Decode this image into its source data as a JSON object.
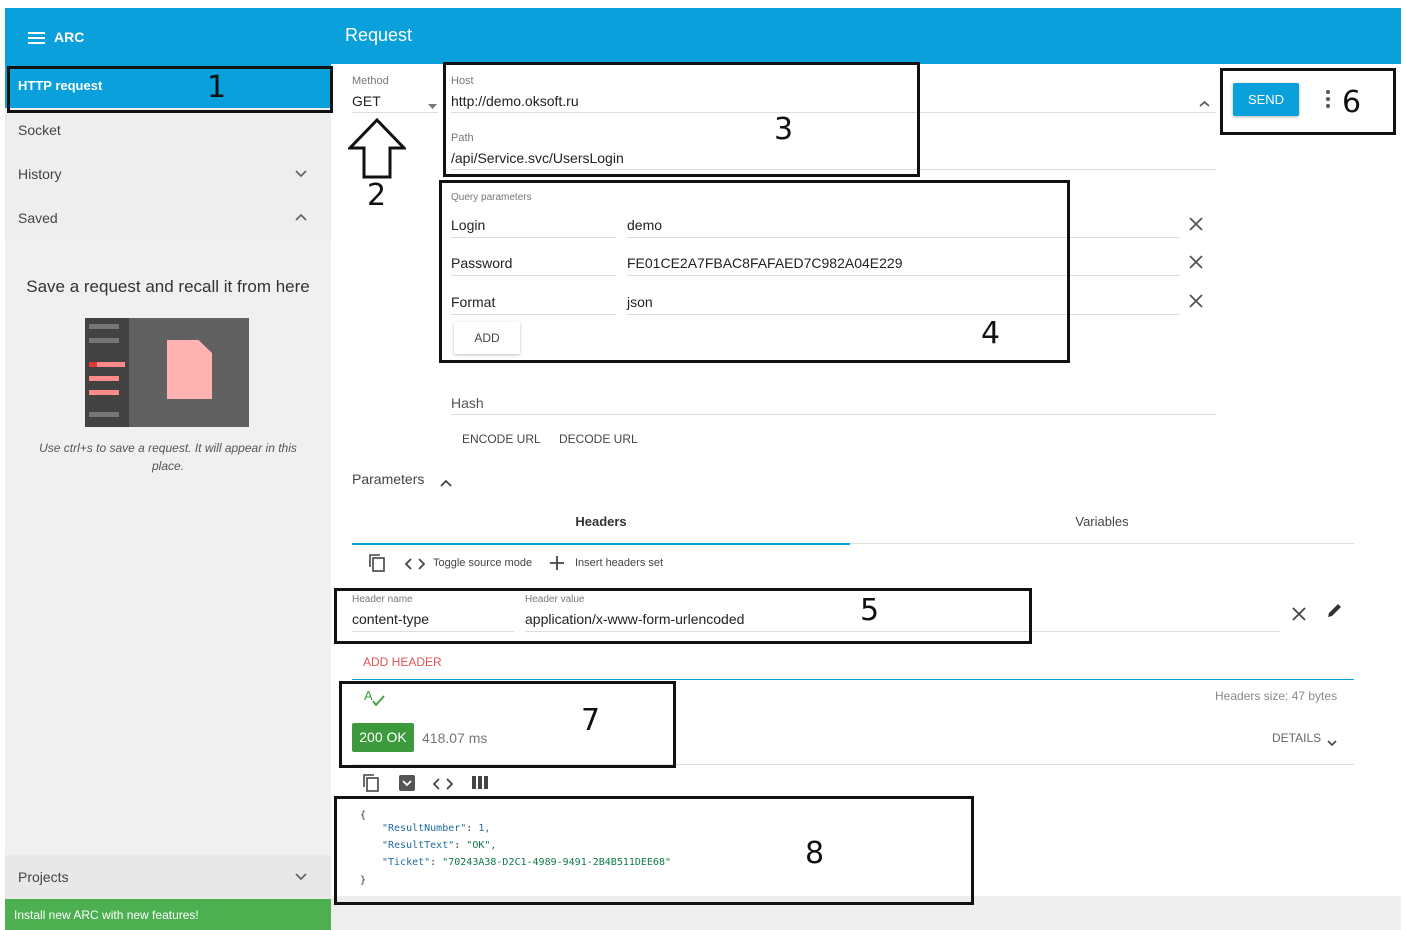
{
  "header": {
    "app_name": "ARC",
    "title": "Request"
  },
  "sidebar": {
    "items": [
      {
        "label": "HTTP request",
        "active": true
      },
      {
        "label": "Socket"
      },
      {
        "label": "History",
        "chevron": "down"
      },
      {
        "label": "Saved",
        "chevron": "up"
      }
    ],
    "saved_title": "Save a request and recall it from here",
    "saved_hint": "Use ctrl+s to save a request. It will appear in this place.",
    "projects_label": "Projects",
    "install_banner": "Install new ARC with new features!"
  },
  "request": {
    "method_label": "Method",
    "method_value": "GET",
    "host_label": "Host",
    "host_value": "http://demo.oksoft.ru",
    "path_label": "Path",
    "path_value": "/api/Service.svc/UsersLogin",
    "send_label": "SEND",
    "query_label": "Query parameters",
    "query_params": [
      {
        "name": "Login",
        "value": "demo"
      },
      {
        "name": "Password",
        "value": "FE01CE2A7FBAC8FAFAED7C982A04E229"
      },
      {
        "name": "Format",
        "value": "json"
      }
    ],
    "add_label": "ADD",
    "hash_label": "Hash",
    "encode_label": "ENCODE URL",
    "decode_label": "DECODE URL",
    "parameters_label": "Parameters"
  },
  "tabs": [
    {
      "label": "Headers",
      "active": true
    },
    {
      "label": "Variables"
    }
  ],
  "headers_toolbar": {
    "toggle_label": "Toggle source mode",
    "insert_label": "Insert headers set"
  },
  "header_row": {
    "name_label": "Header name",
    "name_value": "content-type",
    "value_label": "Header value",
    "value_value": "application/x-www-form-urlencoded"
  },
  "add_header_label": "ADD HEADER",
  "response": {
    "headers_size": "Headers size: 47 bytes",
    "status": "200 OK",
    "time": "418.07 ms",
    "details_label": "DETAILS",
    "body": {
      "open": "{",
      "close": "}",
      "lines": [
        {
          "key": "\"ResultNumber\"",
          "value": "1,"
        },
        {
          "key": "\"ResultText\"",
          "value": "\"OK\","
        },
        {
          "key": "\"Ticket\"",
          "value": "\"70243A38-D2C1-4989-9491-2B4B511DEE68\""
        }
      ]
    }
  },
  "annotations": [
    "1",
    "2",
    "3",
    "4",
    "5",
    "6",
    "7",
    "8"
  ],
  "colors": {
    "accent": "#0aa0dc",
    "status_ok": "#3c9a3c",
    "install_banner": "#4caf50",
    "add_header": "#e05555"
  }
}
